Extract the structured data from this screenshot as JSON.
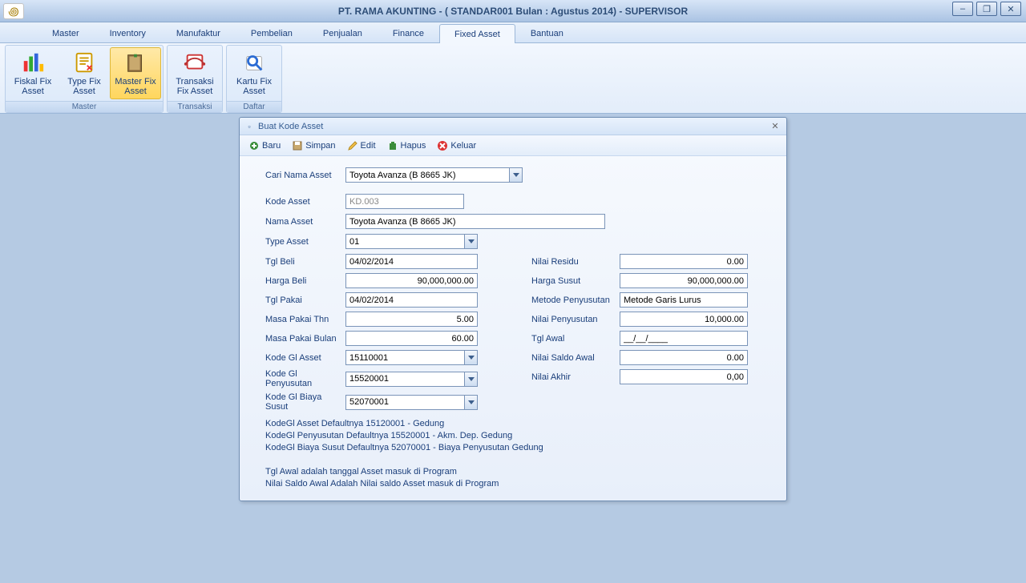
{
  "titlebar": {
    "title": "PT. RAMA AKUNTING - ( STANDAR001  Bulan : Agustus 2014)  - SUPERVISOR"
  },
  "menu": {
    "tabs": [
      "Master",
      "Inventory",
      "Manufaktur",
      "Pembelian",
      "Penjualan",
      "Finance",
      "Fixed Asset",
      "Bantuan"
    ],
    "active": 6
  },
  "ribbon": {
    "groups": [
      {
        "label": "Master",
        "buttons": [
          {
            "label": "Fiskal Fix Asset",
            "name": "fiskal-fix-asset-button"
          },
          {
            "label": "Type Fix Asset",
            "name": "type-fix-asset-button"
          },
          {
            "label": "Master Fix Asset",
            "name": "master-fix-asset-button",
            "active": true
          }
        ]
      },
      {
        "label": "Transaksi",
        "buttons": [
          {
            "label": "Transaksi Fix Asset",
            "name": "transaksi-fix-asset-button"
          }
        ]
      },
      {
        "label": "Daftar",
        "buttons": [
          {
            "label": "Kartu Fix Asset",
            "name": "kartu-fix-asset-button"
          }
        ]
      }
    ]
  },
  "dialog": {
    "title": "Buat Kode Asset",
    "toolbar": [
      "Baru",
      "Simpan",
      "Edit",
      "Hapus",
      "Keluar"
    ],
    "labels": {
      "cariNama": "Cari Nama Asset",
      "kode": "Kode Asset",
      "nama": "Nama Asset",
      "type": "Type Asset",
      "tglBeli": "Tgl Beli",
      "hargaBeli": "Harga Beli",
      "tglPakai": "Tgl Pakai",
      "masaThn": "Masa Pakai Thn",
      "masaBln": "Masa Pakai Bulan",
      "kodeGlAsset": "Kode Gl Asset",
      "kodeGlPeny": "Kode Gl Penyusutan",
      "kodeGlBiaya": "Kode Gl Biaya Susut",
      "nilaiResidu": "Nilai Residu",
      "hargaSusut": "Harga Susut",
      "metode": "Metode Penyusutan",
      "nilaiPeny": "Nilai Penyusutan",
      "tglAwal": "Tgl Awal",
      "saldoAwal": "Nilai Saldo Awal",
      "nilaiAkhir": "Nilai Akhir"
    },
    "values": {
      "cariNama": "Toyota Avanza (B 8665 JK)",
      "kode": "KD.003",
      "nama": "Toyota Avanza (B 8665 JK)",
      "type": "01",
      "tglBeli": "04/02/2014",
      "hargaBeli": "90,000,000.00",
      "tglPakai": "04/02/2014",
      "masaThn": "5.00",
      "masaBln": "60.00",
      "kodeGlAsset": "15110001",
      "kodeGlPeny": "15520001",
      "kodeGlBiaya": "52070001",
      "nilaiResidu": "0.00",
      "hargaSusut": "90,000,000.00",
      "metode": "Metode Garis Lurus",
      "nilaiPeny": "10,000.00",
      "tglAwal": "__/__/____",
      "saldoAwal": "0.00",
      "nilaiAkhir": "0,00"
    },
    "notes": [
      "KodeGl Asset Defaultnya  15120001  - Gedung",
      "KodeGl Penyusutan  Defaultnya  15520001 - Akm. Dep. Gedung",
      "KodeGl Biaya Susut  Defaultnya  52070001 - Biaya Penyusutan Gedung",
      "",
      "Tgl Awal adalah tanggal Asset masuk di Program",
      "Nilai Saldo Awal Adalah Nilai saldo Asset masuk di Program"
    ]
  }
}
